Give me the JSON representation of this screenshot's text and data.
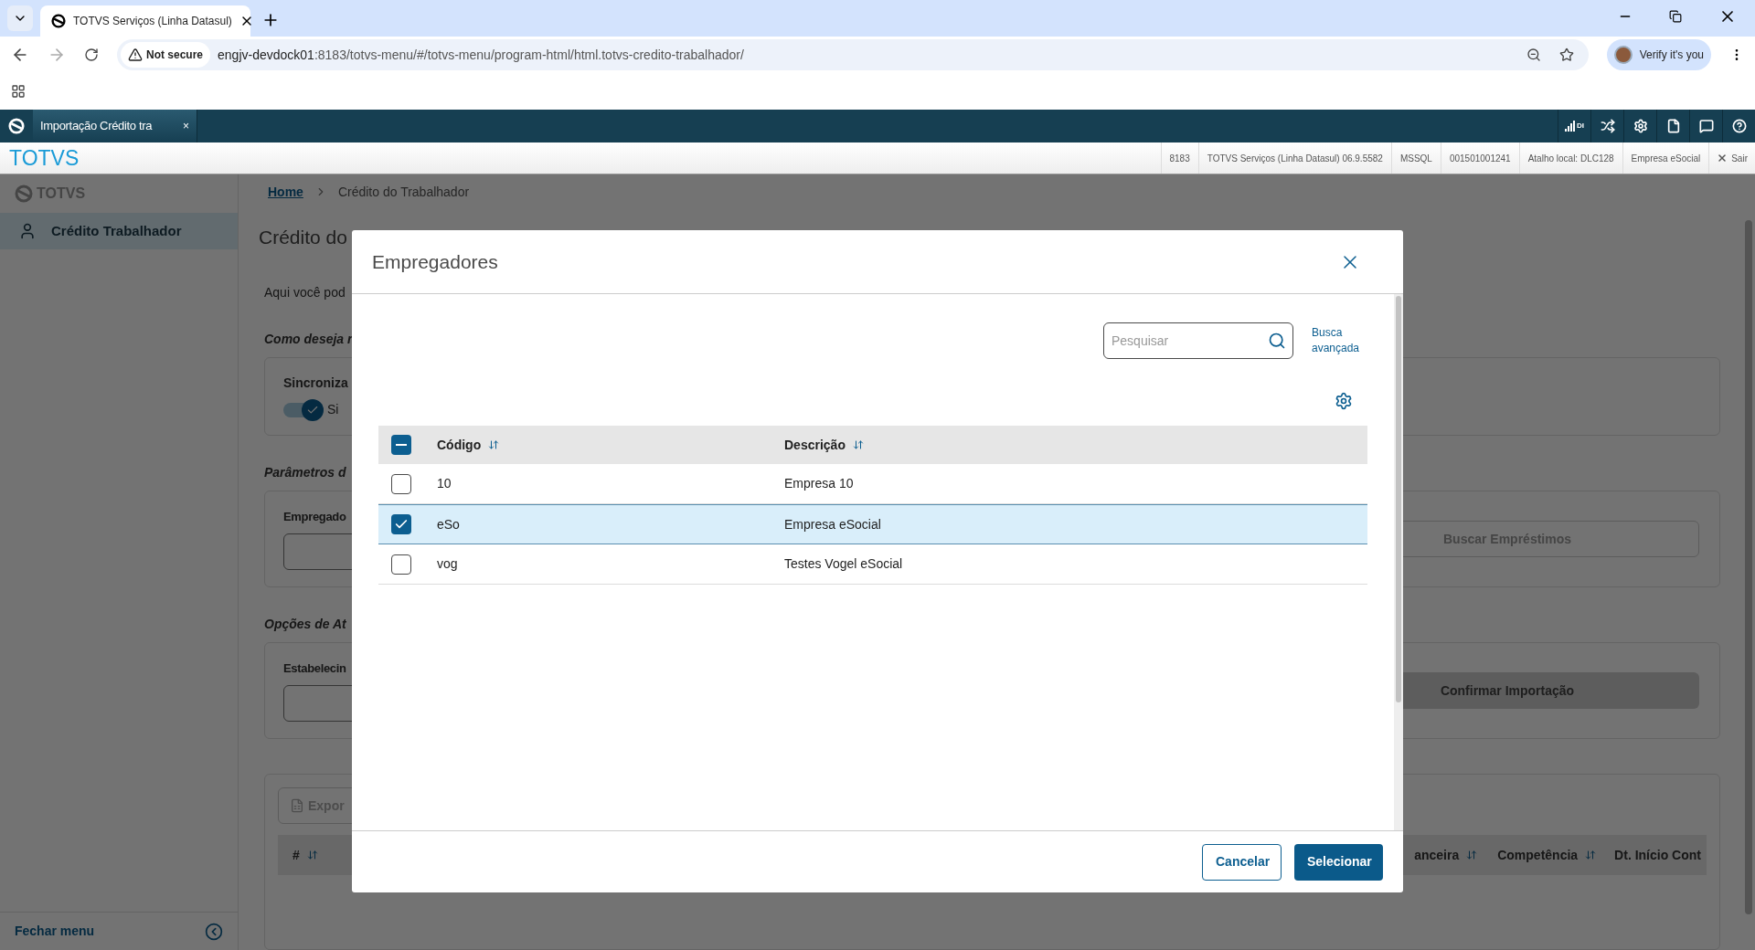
{
  "browser": {
    "tab_title": "TOTVS Serviços (Linha Datasul)",
    "security": "Not secure",
    "url_host": "engjv-devdock01",
    "url_path": ":8183/totvs-menu/#/totvs-menu/program-html/html.totvs-credito-trabalhador/",
    "profile": "Verify it's you"
  },
  "app_bar": {
    "tabs": [
      {
        "label": "Importação Crédito tra",
        "close": "×",
        "selected": true
      }
    ],
    "signal_label": "DI"
  },
  "header": {
    "brand": "TOTVS",
    "info": [
      "8183",
      "TOTVS Serviços (Linha Datasul) 06.9.5582",
      "MSSQL",
      "001501001241",
      "Atalho local: DLC128",
      "Empresa eSocial"
    ],
    "logout": "Sair"
  },
  "sidebar": {
    "brand": "TOTVS",
    "items": [
      {
        "label": "Crédito Trabalhador",
        "selected": true
      }
    ],
    "footer": "Fechar menu"
  },
  "page": {
    "breadcrumb": [
      "Home",
      "Crédito do Trabalhador"
    ],
    "title": "Crédito do",
    "intro": "Aqui você pod",
    "sections": [
      {
        "heading": "Como deseja r",
        "kind": "toggle",
        "label": "Sincroniza",
        "on": true,
        "toggle_text": "Si"
      },
      {
        "heading": "Parâmetros d",
        "kind": "field",
        "label": "Empregado",
        "button": "Buscar Empréstimos",
        "button_filled": false
      },
      {
        "heading": "Opções de At",
        "kind": "field",
        "label": "Estabelecin",
        "button": "Confirmar Importação",
        "button_filled": true
      }
    ],
    "export_button": "Expor",
    "table_columns": [
      "#",
      "anceira",
      "Competência",
      "Dt. Início Cont"
    ]
  },
  "modal": {
    "title": "Empregadores",
    "search": {
      "placeholder": "Pesquisar"
    },
    "advanced_search": "Busca avançada",
    "select_all": {
      "checked": true,
      "indeterminate": true
    },
    "columns": [
      "Código",
      "Descrição"
    ],
    "rows": [
      {
        "code": "10",
        "description": "Empresa 10",
        "selected": false
      },
      {
        "code": "eSo",
        "description": "Empresa eSocial",
        "selected": true
      },
      {
        "code": "vog",
        "description": "Testes Vogel eSocial",
        "selected": false
      }
    ],
    "buttons": [
      {
        "label": "Cancelar",
        "kind": "secondary"
      },
      {
        "label": "Selecionar",
        "kind": "primary"
      }
    ]
  }
}
